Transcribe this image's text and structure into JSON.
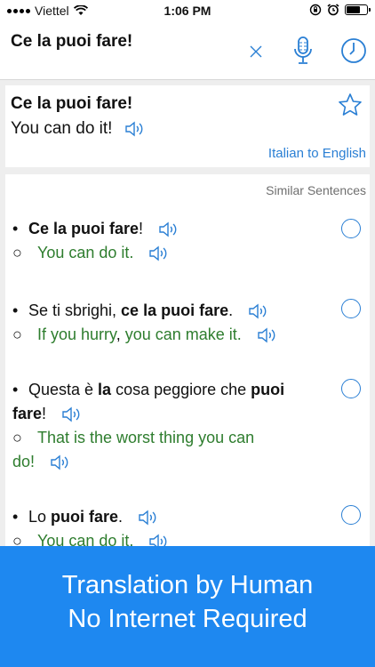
{
  "status": {
    "carrier": "Viettel",
    "time": "1:06 PM"
  },
  "search": {
    "query": "Ce la puoi fare!"
  },
  "result": {
    "source": "Ce la puoi fare!",
    "translation": "You can do it!",
    "direction": "Italian to English"
  },
  "similar": {
    "title": "Similar Sentences",
    "items": [
      {
        "source_parts": [
          [
            "Ce la puoi fare",
            true
          ],
          [
            "!",
            false
          ]
        ],
        "target_parts": [
          [
            "You can do it.",
            false
          ]
        ]
      },
      {
        "source_parts": [
          [
            "Se ti sbrighi, ",
            false
          ],
          [
            "ce la puoi fare",
            true
          ],
          [
            ".",
            false
          ]
        ],
        "target_parts": [
          [
            "If you hurry",
            false
          ],
          [
            ", ",
            "dark"
          ],
          [
            "you can make it.",
            false
          ]
        ]
      },
      {
        "source_parts": [
          [
            "Questa è ",
            false
          ],
          [
            "la",
            true
          ],
          [
            " cosa peggiore che ",
            false
          ],
          [
            "puoi",
            true
          ]
        ],
        "source_line2": [
          [
            "fare",
            true
          ],
          [
            "!",
            false
          ]
        ],
        "target_parts": [
          [
            "That is the worst thing you can",
            false
          ]
        ],
        "target_line2": "do!"
      },
      {
        "source_parts": [
          [
            "Lo ",
            false
          ],
          [
            "puoi fare",
            true
          ],
          [
            ".",
            false
          ]
        ],
        "target_parts": [
          [
            "You can do it.",
            false
          ]
        ]
      }
    ]
  },
  "banner": {
    "line1": "Translation by Human",
    "line2": "No Internet Required"
  },
  "colors": {
    "accent": "#2a7fd4",
    "banner": "#1e88f0",
    "green": "#2e7d2e"
  }
}
